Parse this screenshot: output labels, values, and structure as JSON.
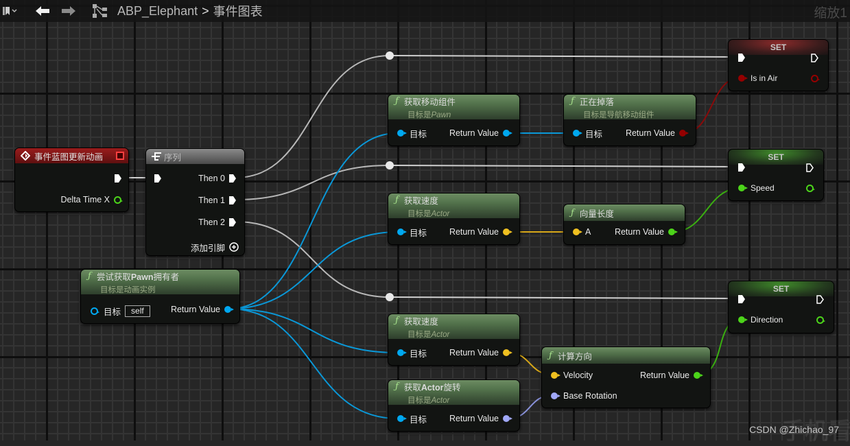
{
  "toolbar": {
    "bookmark_icon": "bookmark-icon",
    "back_icon": "arrow-left-icon",
    "forward_icon": "arrow-right-icon",
    "graph_icon": "graph-hierarchy-icon",
    "breadcrumb": [
      "ABP_Elephant",
      "事件图表"
    ],
    "breadcrumb_sep": ">",
    "zoom_label": "缩放1"
  },
  "nodes": {
    "event": {
      "title": "事件蓝图更新动画",
      "pins": {
        "delta": "Delta Time X"
      }
    },
    "sequence": {
      "title": "序列",
      "then0": "Then 0",
      "then1": "Then 1",
      "then2": "Then 2",
      "add_pin": "添加引脚"
    },
    "try_get_pawn": {
      "title_a": "尝试获取",
      "title_b": "Pawn",
      "title_c": "拥有者",
      "subtitle": "目标是动画实例",
      "target": "目标",
      "self_value": "self",
      "return": "Return Value"
    },
    "get_movement": {
      "title": "获取移动组件",
      "subtitle_a": "目标是",
      "subtitle_b": "Pawn",
      "target": "目标",
      "return": "Return Value"
    },
    "is_falling": {
      "title": "正在掉落",
      "subtitle": "目标是导航移动组件",
      "target": "目标",
      "return": "Return Value"
    },
    "get_velocity1": {
      "title": "获取速度",
      "subtitle_a": "目标是",
      "subtitle_b": "Actor",
      "target": "目标",
      "return": "Return Value"
    },
    "vector_length": {
      "title": "向量长度",
      "a": "A",
      "return": "Return Value"
    },
    "get_velocity2": {
      "title": "获取速度",
      "subtitle_a": "目标是",
      "subtitle_b": "Actor",
      "target": "目标",
      "return": "Return Value"
    },
    "get_rotation": {
      "title_a": "获取",
      "title_b": "Actor",
      "title_c": "旋转",
      "subtitle_a": "目标是",
      "subtitle_b": "Actor",
      "target": "目标",
      "return": "Return Value"
    },
    "calc_direction": {
      "title": "计算方向",
      "velocity": "Velocity",
      "base_rotation": "Base Rotation",
      "return": "Return Value"
    },
    "set_in_air": {
      "title": "SET",
      "var": "Is in Air"
    },
    "set_speed": {
      "title": "SET",
      "var": "Speed"
    },
    "set_direction": {
      "title": "SET",
      "var": "Direction"
    }
  },
  "colors": {
    "exec": "#ffffff",
    "object": "#00a8f0",
    "bool": "#950000",
    "float": "#4cd41a",
    "vector": "#f0c020",
    "rotator": "#a0a8f8"
  },
  "watermark": "CSDN @Zhichao_97"
}
